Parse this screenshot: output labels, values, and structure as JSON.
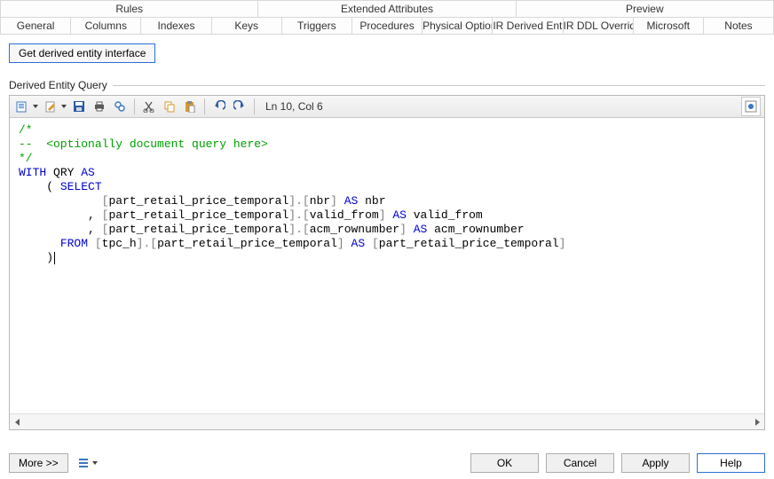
{
  "tabs_row1": [
    {
      "id": "rules",
      "label": "Rules"
    },
    {
      "id": "ext",
      "label": "Extended Attributes"
    },
    {
      "id": "preview",
      "label": "Preview"
    }
  ],
  "tabs_row2": [
    {
      "id": "general",
      "label": "General"
    },
    {
      "id": "columns",
      "label": "Columns"
    },
    {
      "id": "indexes",
      "label": "Indexes"
    },
    {
      "id": "keys",
      "label": "Keys"
    },
    {
      "id": "triggers",
      "label": "Triggers"
    },
    {
      "id": "procedures",
      "label": "Procedures"
    },
    {
      "id": "physical",
      "label": "Physical Options"
    },
    {
      "id": "ir-derived",
      "label": "IR Derived Entity",
      "active": true
    },
    {
      "id": "ir-ddl",
      "label": "IR DDL Override"
    },
    {
      "id": "microsoft",
      "label": "Microsoft"
    },
    {
      "id": "notes",
      "label": "Notes"
    }
  ],
  "get_button": "Get derived entity interface",
  "section_title": "Derived Entity Query",
  "cursor_status": "Ln 10, Col 6",
  "code_lines": [
    {
      "type": "cmt",
      "text": "/*"
    },
    {
      "type": "cmt",
      "text": "--  <optionally document query here>"
    },
    {
      "type": "cmt",
      "text": "*/"
    },
    {
      "type": "with",
      "with": "WITH",
      "qry": " QRY ",
      "as": "AS"
    },
    {
      "type": "sel",
      "indent": "    ( ",
      "select": "SELECT"
    },
    {
      "type": "col",
      "indent": "            ",
      "open": "[",
      "t": "part_retail_price_temporal",
      "dot": "].[",
      "c": "nbr",
      "close": "] ",
      "as": "AS",
      "alias": " nbr"
    },
    {
      "type": "col",
      "indent": "          , ",
      "open": "[",
      "t": "part_retail_price_temporal",
      "dot": "].[",
      "c": "valid_from",
      "close": "] ",
      "as": "AS",
      "alias": " valid_from"
    },
    {
      "type": "col",
      "indent": "          , ",
      "open": "[",
      "t": "part_retail_price_temporal",
      "dot": "].[",
      "c": "acm_rownumber",
      "close": "] ",
      "as": "AS",
      "alias": " acm_rownumber"
    },
    {
      "type": "from",
      "indent": "      ",
      "from": "FROM",
      "sp": " ",
      "open": "[",
      "s": "tpc_h",
      "dot": "].[",
      "t": "part_retail_price_temporal",
      "close": "] ",
      "as": "AS",
      "sp2": " ",
      "open2": "[",
      "a": "part_retail_price_temporal",
      "close2": "]"
    },
    {
      "type": "end",
      "indent": "    )",
      "cursor": true
    }
  ],
  "toolbar_icons": [
    {
      "name": "edit-script-icon",
      "drop": true,
      "color": "#3a78c3"
    },
    {
      "name": "edit-icon",
      "drop": true,
      "color": "#d99a2b"
    },
    {
      "name": "save-icon",
      "color": "#2c5aa0"
    },
    {
      "name": "print-icon",
      "color": "#5a5a5a"
    },
    {
      "name": "find-icon",
      "color": "#3a78c3"
    },
    {
      "name": "sep"
    },
    {
      "name": "cut-icon",
      "color": "#5a5a5a"
    },
    {
      "name": "copy-icon",
      "color": "#d99a2b"
    },
    {
      "name": "paste-icon",
      "color": "#d99a2b"
    },
    {
      "name": "sep"
    },
    {
      "name": "undo-icon",
      "color": "#2c5aa0"
    },
    {
      "name": "redo-icon",
      "color": "#2c5aa0"
    },
    {
      "name": "sep"
    }
  ],
  "execute_icon": "execute-sql-icon",
  "bottom": {
    "more": "More >>",
    "menu_icon": "menu-icon",
    "buttons": [
      {
        "id": "ok",
        "label": "OK"
      },
      {
        "id": "cancel",
        "label": "Cancel"
      },
      {
        "id": "apply",
        "label": "Apply"
      },
      {
        "id": "help",
        "label": "Help",
        "highlight": true
      }
    ]
  }
}
